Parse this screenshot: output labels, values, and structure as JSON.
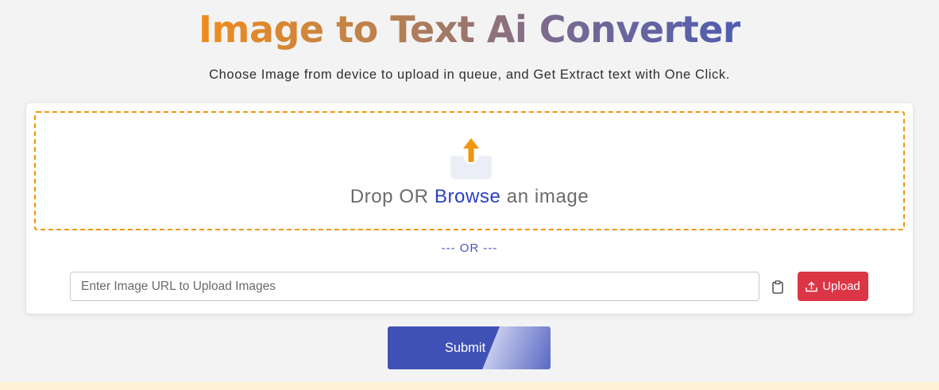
{
  "header": {
    "title": "Image to Text Ai Converter",
    "subtitle": "Choose Image from device to upload in queue, and Get Extract text with One Click."
  },
  "dropzone": {
    "text_before": "Drop OR ",
    "browse_label": "Browse",
    "text_after": " an image",
    "icon": "upload-tray-icon"
  },
  "separator": "--- OR ---",
  "url_upload": {
    "placeholder": "Enter Image URL to Upload Images",
    "value": "",
    "clipboard_icon": "clipboard-icon",
    "upload_label": "Upload",
    "upload_icon": "upload-icon"
  },
  "submit_label": "Submit",
  "colors": {
    "title_start": "#ef8d1c",
    "title_end": "#4f5db2",
    "dropzone_border": "#f0960e",
    "browse_link": "#2d3fc4",
    "upload_button": "#dc3545",
    "submit_button": "#3f51b5"
  }
}
